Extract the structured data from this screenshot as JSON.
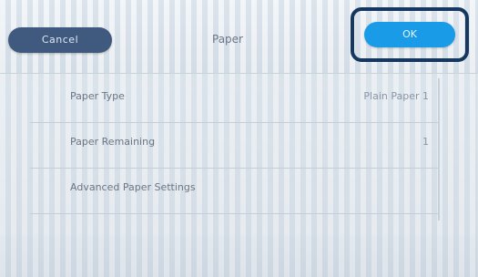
{
  "header": {
    "cancel_label": "Cancel",
    "title": "Paper",
    "ok_label": "OK"
  },
  "settings": [
    {
      "label": "Paper Type",
      "value": "Plain Paper 1"
    },
    {
      "label": "Paper Remaining",
      "value": "1"
    },
    {
      "label": "Advanced Paper Settings",
      "value": ""
    }
  ]
}
